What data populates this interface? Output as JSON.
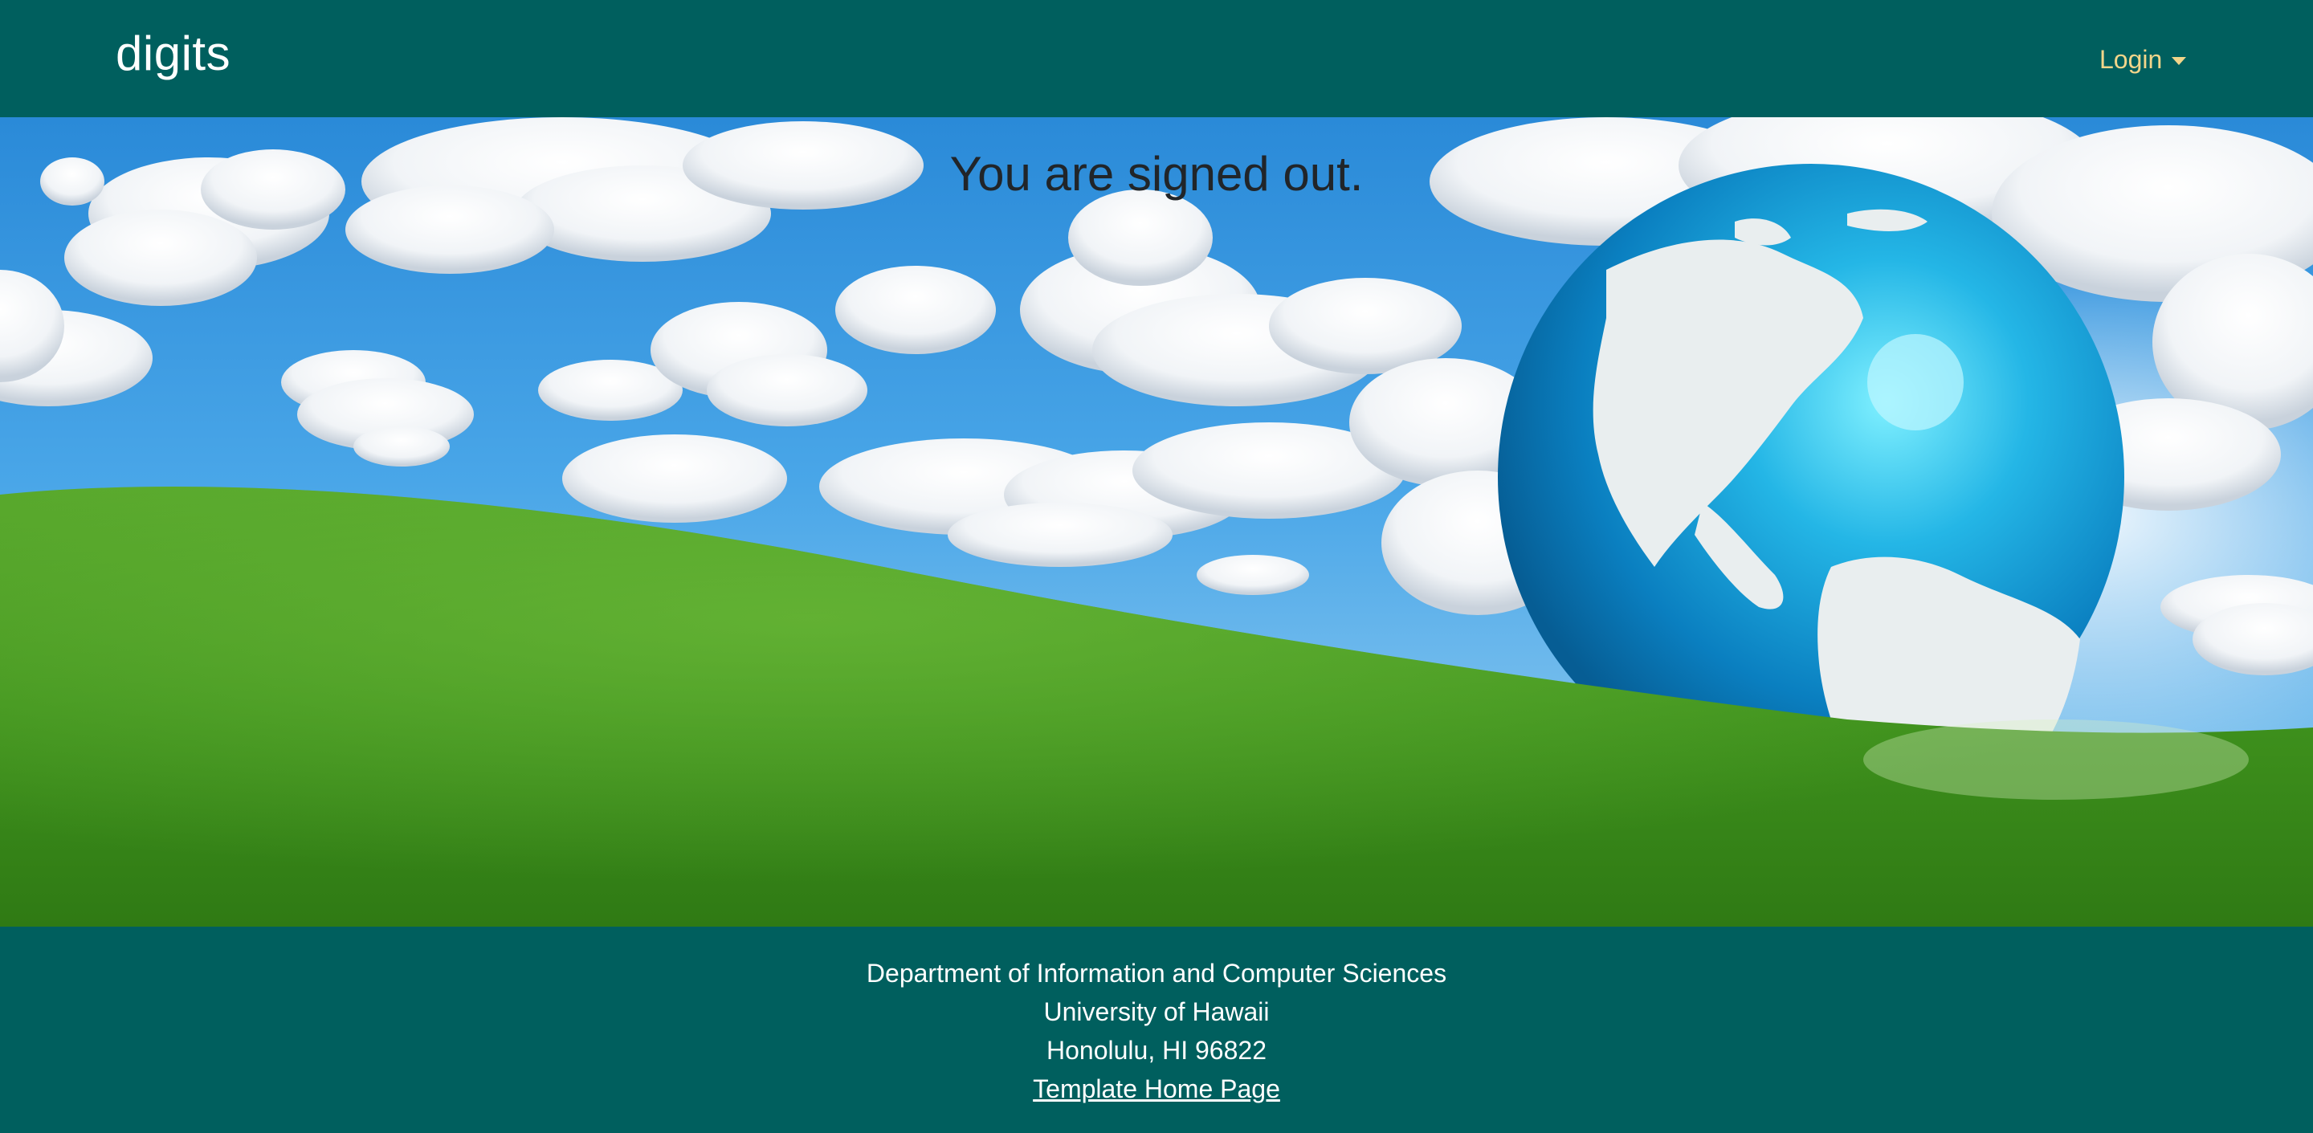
{
  "navbar": {
    "brand": "digits",
    "login_label": "Login"
  },
  "hero": {
    "heading": "You are signed out."
  },
  "footer": {
    "department": "Department of Information and Computer Sciences",
    "university": "University of Hawaii",
    "city": "Honolulu, HI 96822",
    "link_label": "Template Home Page"
  },
  "colors": {
    "brand_teal": "#005f5e",
    "login_gold": "#f2d58a",
    "heading_dark": "#212529"
  },
  "icons": {
    "login_caret": "chevron-down-icon"
  }
}
